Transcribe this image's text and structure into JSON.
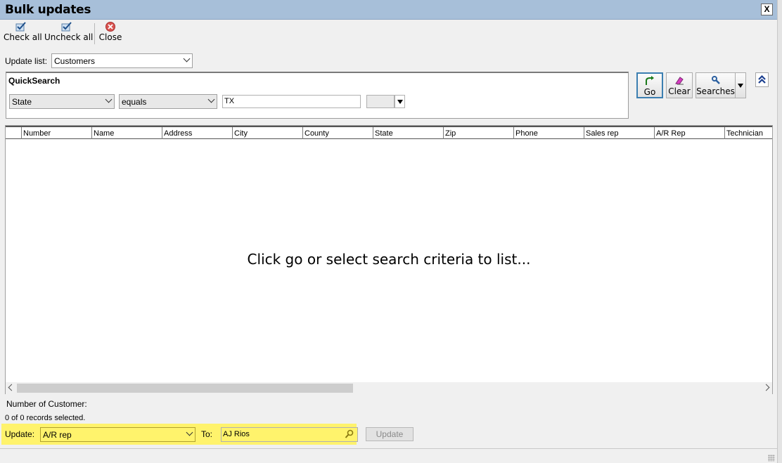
{
  "window": {
    "title": "Bulk updates",
    "close_glyph": "X"
  },
  "toolbar": {
    "check_all": "Check all",
    "uncheck_all": "Uncheck all",
    "close": "Close"
  },
  "update_list": {
    "label": "Update list:",
    "value": "Customers"
  },
  "quicksearch": {
    "title": "QuickSearch",
    "field": "State",
    "operator": "equals",
    "value": "TX"
  },
  "buttons": {
    "go": "Go",
    "clear": "Clear",
    "searches": "Searches"
  },
  "grid": {
    "columns": [
      "Number",
      "Name",
      "Address",
      "City",
      "County",
      "State",
      "Zip",
      "Phone",
      "Sales rep",
      "A/R Rep",
      "Technician"
    ],
    "empty_message": "Click go or select search criteria to list..."
  },
  "footer": {
    "count_label": "Number of Customer:",
    "records_selected": "0 of 0 records selected.",
    "update_label": "Update:",
    "update_field": "A/R rep",
    "to_label": "To:",
    "to_value": "AJ Rios",
    "update_button": "Update"
  },
  "colors": {
    "titlebar": "#a7bfd9",
    "highlight": "#fff36c",
    "go_border": "#3c7fb1"
  }
}
